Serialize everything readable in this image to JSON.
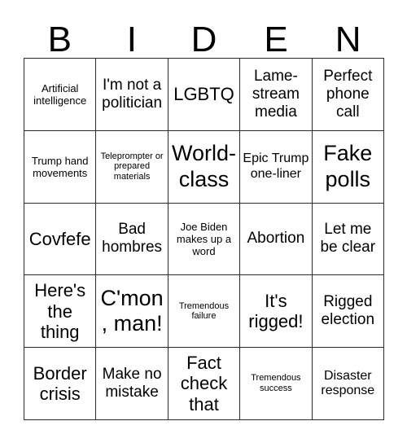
{
  "card": {
    "title_letters": [
      "B",
      "I",
      "D",
      "E",
      "N"
    ],
    "columns": 5,
    "rows": 5,
    "border_color": "#2b2b2b",
    "background_color": "#ffffff",
    "text_color": "#000000",
    "cells": [
      {
        "text": "Artificial intelligence",
        "size": "sm",
        "marked": false
      },
      {
        "text": "I'm not a politician",
        "size": "lg",
        "marked": false
      },
      {
        "text": "LGBTQ",
        "size": "xl",
        "marked": false
      },
      {
        "text": "Lame-stream media",
        "size": "lg",
        "marked": false
      },
      {
        "text": "Perfect phone call",
        "size": "lg",
        "marked": false
      },
      {
        "text": "Trump hand movements",
        "size": "sm",
        "marked": false
      },
      {
        "text": "Teleprompter or prepared materials",
        "size": "xs",
        "marked": false
      },
      {
        "text": "World-class",
        "size": "xxl",
        "marked": false
      },
      {
        "text": "Epic Trump one-liner",
        "size": "md",
        "marked": false
      },
      {
        "text": "Fake polls",
        "size": "xxl",
        "marked": false
      },
      {
        "text": "Covfefe",
        "size": "xl",
        "marked": false
      },
      {
        "text": "Bad hombres",
        "size": "lg",
        "marked": false
      },
      {
        "text": "Joe Biden makes up a word",
        "size": "sm",
        "marked": false
      },
      {
        "text": "Abortion",
        "size": "lg",
        "marked": false
      },
      {
        "text": "Let me be clear",
        "size": "lg",
        "marked": false
      },
      {
        "text": "Here's the thing",
        "size": "xl",
        "marked": false
      },
      {
        "text": "C'mon, man!",
        "size": "xxl",
        "marked": false
      },
      {
        "text": "Tremendous failure",
        "size": "xs",
        "marked": false
      },
      {
        "text": "It's rigged!",
        "size": "xl",
        "marked": false
      },
      {
        "text": "Rigged election",
        "size": "lg",
        "marked": false
      },
      {
        "text": "Border crisis",
        "size": "xl",
        "marked": false
      },
      {
        "text": "Make no mistake",
        "size": "lg",
        "marked": false
      },
      {
        "text": "Fact check that",
        "size": "xl",
        "marked": false
      },
      {
        "text": "Tremendous success",
        "size": "xs",
        "marked": false
      },
      {
        "text": "Disaster response",
        "size": "md",
        "marked": false
      }
    ]
  }
}
